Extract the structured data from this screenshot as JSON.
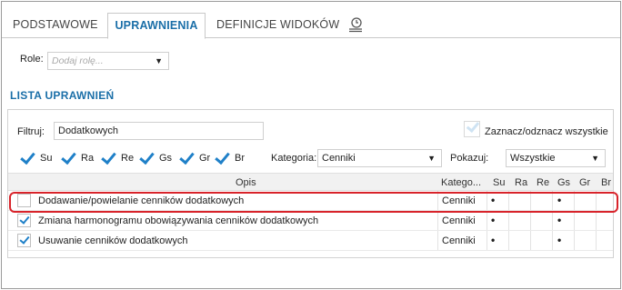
{
  "tabs": [
    {
      "label": "PODSTAWOWE"
    },
    {
      "label": "UPRAWNIENIA"
    },
    {
      "label": "DEFINICJE WIDOKÓW"
    }
  ],
  "role": {
    "label": "Role:",
    "placeholder": "Dodaj rolę..."
  },
  "section_title": "LISTA UPRAWNIEŃ",
  "filter": {
    "label": "Filtruj:",
    "value": "Dodatkowych"
  },
  "toggle_all_label": "Zaznacz/odznacz wszystkie",
  "permission_flags": [
    "Su",
    "Ra",
    "Re",
    "Gs",
    "Gr",
    "Br"
  ],
  "category": {
    "label": "Kategoria:",
    "value": "Cenniki"
  },
  "show": {
    "label": "Pokazuj:",
    "value": "Wszystkie"
  },
  "grid": {
    "headers": {
      "desc": "Opis",
      "cat": "Katego...",
      "cols": [
        "Su",
        "Ra",
        "Re",
        "Gs",
        "Gr",
        "Br"
      ]
    },
    "rows": [
      {
        "checked": false,
        "desc": "Dodawanie/powielanie cenników dodatkowych",
        "cat": "Cenniki",
        "dot": "•"
      },
      {
        "checked": true,
        "desc": "Zmiana harmonogramu obowiązywania cenników dodatkowych",
        "cat": "Cenniki",
        "dot": "•"
      },
      {
        "checked": true,
        "desc": "Usuwanie cenników dodatkowych",
        "cat": "Cenniki",
        "dot": "•"
      }
    ]
  },
  "colors": {
    "accent": "#1b6fa8",
    "check": "#1f80c8",
    "highlight": "#d8232a"
  }
}
